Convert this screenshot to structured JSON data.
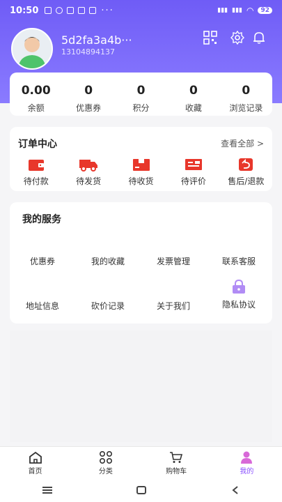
{
  "status_bar": {
    "time": "10:50",
    "battery": "92"
  },
  "profile": {
    "username": "5d2fa3a4b···",
    "phone": "13104894137"
  },
  "stats": [
    {
      "value": "0.00",
      "label": "余额"
    },
    {
      "value": "0",
      "label": "优惠券"
    },
    {
      "value": "0",
      "label": "积分"
    },
    {
      "value": "0",
      "label": "收藏"
    },
    {
      "value": "0",
      "label": "浏览记录"
    }
  ],
  "orders": {
    "title": "订单中心",
    "view_all": "查看全部 >",
    "items": [
      {
        "label": "待付款",
        "icon": "wallet-icon"
      },
      {
        "label": "待发货",
        "icon": "truck-icon"
      },
      {
        "label": "待收货",
        "icon": "package-icon"
      },
      {
        "label": "待评价",
        "icon": "review-icon"
      },
      {
        "label": "售后/退款",
        "icon": "refund-icon"
      }
    ]
  },
  "services": {
    "title": "我的服务",
    "items": [
      {
        "label": "优惠券"
      },
      {
        "label": "我的收藏"
      },
      {
        "label": "发票管理"
      },
      {
        "label": "联系客服"
      },
      {
        "label": "地址信息"
      },
      {
        "label": "砍价记录"
      },
      {
        "label": "关于我们"
      },
      {
        "label": "隐私协议",
        "icon": "lock-icon"
      }
    ]
  },
  "tabbar": {
    "items": [
      {
        "label": "首页",
        "icon": "home-icon"
      },
      {
        "label": "分类",
        "icon": "category-icon"
      },
      {
        "label": "购物车",
        "icon": "cart-icon"
      },
      {
        "label": "我的",
        "icon": "user-icon"
      }
    ],
    "active_color": "#8a50ff"
  },
  "colors": {
    "header": "#6f5cf6",
    "order_icon": "#e8372b"
  }
}
